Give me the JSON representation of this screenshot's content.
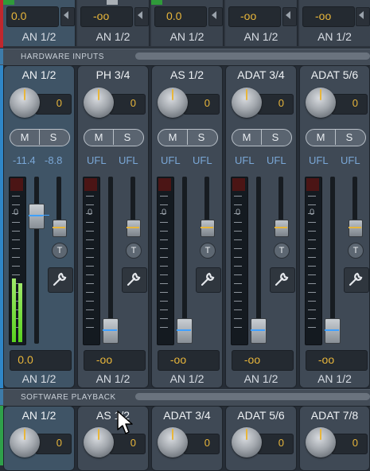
{
  "top_strips": [
    {
      "value": "0.0",
      "route": "AN 1/2"
    },
    {
      "value": "-oo",
      "route": "AN 1/2"
    },
    {
      "value": "0.0",
      "route": "AN 1/2"
    },
    {
      "value": "-oo",
      "route": "AN 1/2"
    },
    {
      "value": "-oo",
      "route": "AN 1/2"
    }
  ],
  "sections": {
    "hardware_inputs": "HARDWARE INPUTS",
    "software_playback": "SOFTWARE PLAYBACK"
  },
  "hardware_channels": [
    {
      "name": "AN 1/2",
      "gain": "0",
      "mute": "M",
      "solo": "S",
      "level_l": "-11.4",
      "level_r": "-8.8",
      "fader_value": "0.0",
      "route": "AN 1/2",
      "t": "T"
    },
    {
      "name": "PH 3/4",
      "gain": "0",
      "mute": "M",
      "solo": "S",
      "level_l": "UFL",
      "level_r": "UFL",
      "fader_value": "-oo",
      "route": "AN 1/2",
      "t": "T"
    },
    {
      "name": "AS 1/2",
      "gain": "0",
      "mute": "M",
      "solo": "S",
      "level_l": "UFL",
      "level_r": "UFL",
      "fader_value": "-oo",
      "route": "AN 1/2",
      "t": "T"
    },
    {
      "name": "ADAT 3/4",
      "gain": "0",
      "mute": "M",
      "solo": "S",
      "level_l": "UFL",
      "level_r": "UFL",
      "fader_value": "-oo",
      "route": "AN 1/2",
      "t": "T"
    },
    {
      "name": "ADAT 5/6",
      "gain": "0",
      "mute": "M",
      "solo": "S",
      "level_l": "UFL",
      "level_r": "UFL",
      "fader_value": "-oo",
      "route": "AN 1/2",
      "t": "T"
    }
  ],
  "meter_zero_label": "0",
  "software_channels": [
    {
      "name": "AN 1/2",
      "gain": "0"
    },
    {
      "name": "AS 1/2",
      "gain": "0"
    },
    {
      "name": "ADAT 3/4",
      "gain": "0"
    },
    {
      "name": "ADAT 5/6",
      "gain": "0"
    },
    {
      "name": "ADAT 7/8",
      "gain": "0"
    }
  ],
  "meter_levels": [
    0.42,
    0,
    0,
    0,
    0
  ],
  "colors": {
    "accent": "#e8b63b",
    "level_blue": "#7aa7d6",
    "meter_green": "#58d21e"
  }
}
